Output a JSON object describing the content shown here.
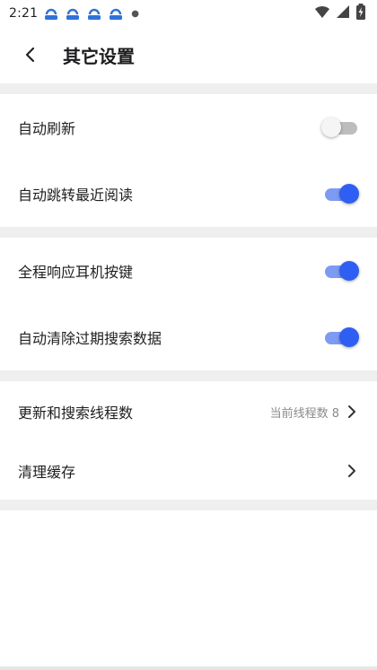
{
  "status": {
    "time": "2:21",
    "icons": [
      "app-notification-icon",
      "app-notification-icon",
      "app-notification-icon",
      "app-notification-icon",
      "more-notifications-dot",
      "wifi-icon",
      "signal-icon",
      "battery-charging-icon"
    ]
  },
  "header": {
    "title": "其它设置",
    "back_icon": "chevron-left-icon"
  },
  "groups": [
    {
      "rows": [
        {
          "label": "自动刷新",
          "toggle": false
        },
        {
          "label": "自动跳转最近阅读",
          "toggle": true
        }
      ]
    },
    {
      "rows": [
        {
          "label": "全程响应耳机按键",
          "toggle": true
        },
        {
          "label": "自动清除过期搜索数据",
          "toggle": true
        }
      ]
    },
    {
      "rows": [
        {
          "label": "更新和搜索线程数",
          "value": "当前线程数 8",
          "icon": "chevron-right-icon"
        },
        {
          "label": "清理缓存",
          "icon": "chevron-right-icon"
        }
      ]
    }
  ],
  "colors": {
    "accent": "#2f5ff2",
    "accent_track": "#7e9bf3",
    "off_track": "#bdbdbd",
    "divider": "#efefef"
  }
}
